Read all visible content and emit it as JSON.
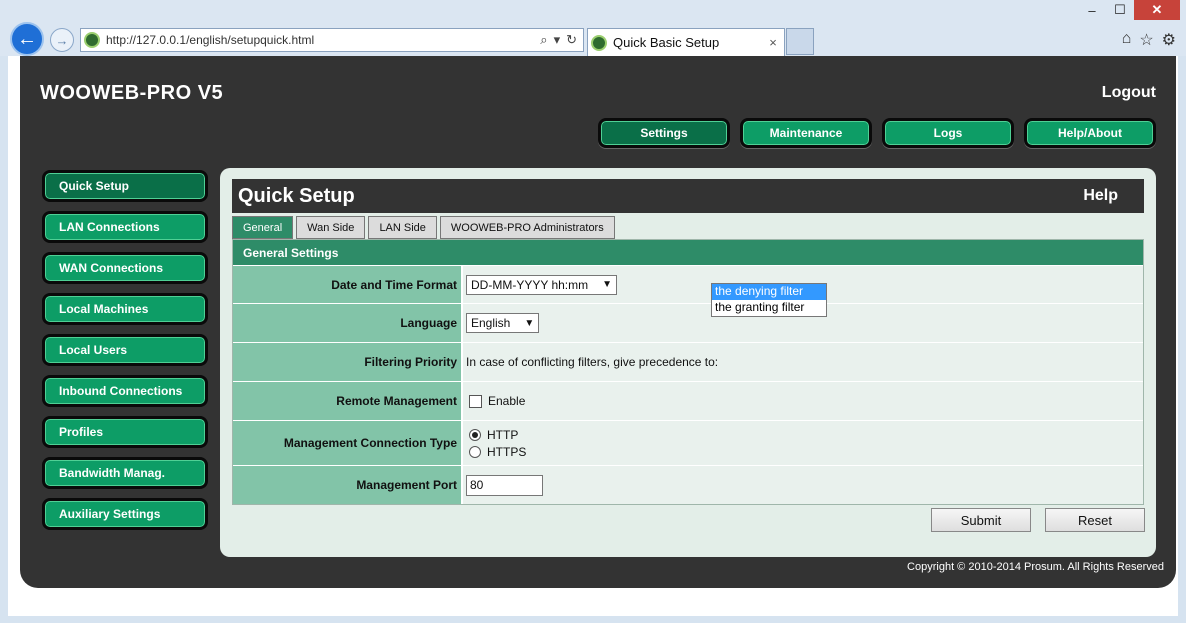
{
  "browser": {
    "url": "http://127.0.0.1/english/setupquick.html",
    "tab_title": "Quick Basic Setup",
    "tab_close": "×",
    "minimize": "–",
    "maximize": "☐",
    "close": "✕"
  },
  "app": {
    "brand": "WOOWEB-PRO V5",
    "logout": "Logout",
    "top_nav": [
      "Settings",
      "Maintenance",
      "Logs",
      "Help/About"
    ],
    "top_nav_active": 0,
    "side_nav": [
      "Quick Setup",
      "LAN Connections",
      "WAN Connections",
      "Local Machines",
      "Local Users",
      "Inbound Connections",
      "Profiles",
      "Bandwidth Manag.",
      "Auxiliary Settings"
    ],
    "side_nav_active": 0,
    "copyright": "Copyright © 2010-2014 Prosum. All Rights Reserved"
  },
  "panel": {
    "title": "Quick Setup",
    "help": "Help",
    "tabs": [
      "General",
      "Wan Side",
      "LAN Side",
      "WOOWEB-PRO Administrators"
    ],
    "tab_active": 0,
    "section": "General Settings",
    "date_format_label": "Date and Time Format",
    "date_format_value": "DD-MM-YYYY hh:mm",
    "language_label": "Language",
    "language_value": "English",
    "filtering_label": "Filtering Priority",
    "filtering_text": "In case of conflicting filters, give precedence to:",
    "filtering_options": [
      "the denying filter",
      "the granting filter"
    ],
    "filtering_selected": 0,
    "remote_label": "Remote Management",
    "remote_enable": "Enable",
    "conn_type_label": "Management Connection Type",
    "conn_http": "HTTP",
    "conn_https": "HTTPS",
    "port_label": "Management Port",
    "port_value": "80",
    "submit": "Submit",
    "reset": "Reset"
  },
  "colors": {
    "accent_green": "#0d9d66",
    "active_green": "#0a6f48",
    "section_green": "#2e8c68",
    "label_green": "#82c4a8",
    "app_dark": "#333333"
  }
}
